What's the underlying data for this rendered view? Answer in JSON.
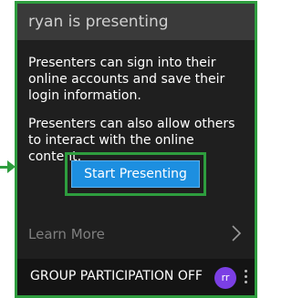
{
  "header": {
    "title": "ryan is presenting"
  },
  "body": {
    "paragraph_1": "Presenters can sign into their online accounts and save their login information.",
    "paragraph_2": "Presenters can also allow others to interact with the online content."
  },
  "start_button": {
    "label": "Start Presenting",
    "color": "#1d8fe0"
  },
  "learn_more": {
    "label": "Learn More",
    "icon": "chevron-right-icon"
  },
  "footer": {
    "participation_label": "GROUP PARTICIPATION OFF",
    "avatar_initials": "rr",
    "avatar_color": "#7b3fe4",
    "more_icon": "more-vertical-icon"
  },
  "highlight_color": "#2e9d3e"
}
